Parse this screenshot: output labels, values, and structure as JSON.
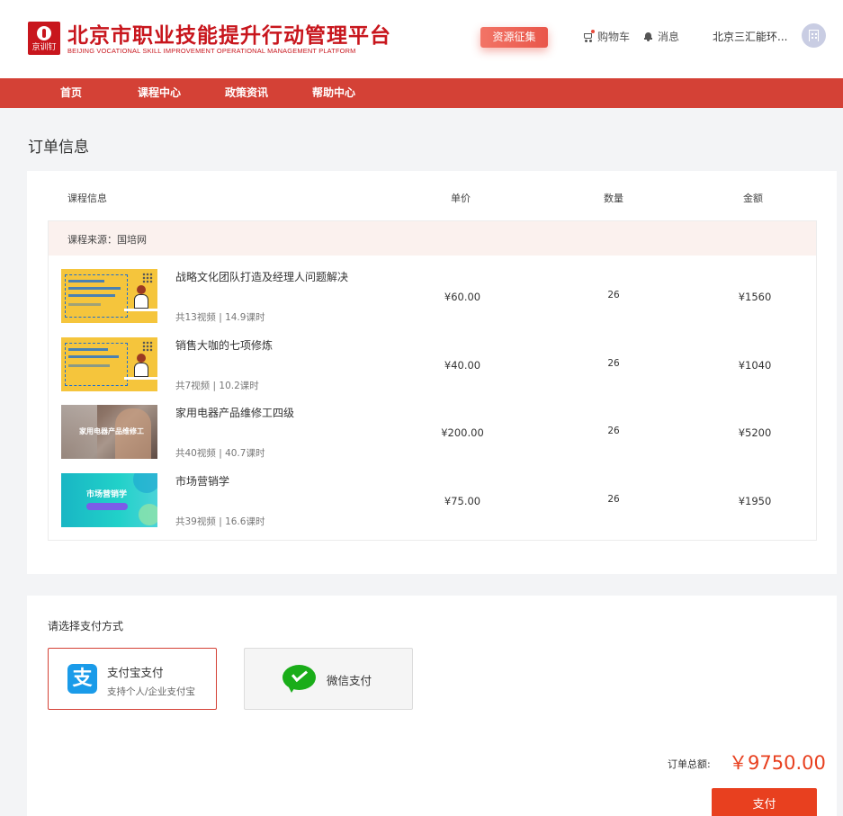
{
  "header": {
    "logo_mini_text": "京训钉",
    "brand_cn": "北京市职业技能提升行动管理平台",
    "brand_en": "BEIJING VOCATIONAL SKILL IMPROVEMENT OPERATIONAL MANAGEMENT PLATFORM",
    "resource_button": "资源征集",
    "cart_label": "购物车",
    "message_label": "消息",
    "user_name": "北京三汇能环..."
  },
  "nav": {
    "items": [
      "首页",
      "课程中心",
      "政策资讯",
      "帮助中心"
    ]
  },
  "page_title": "订单信息",
  "order_table": {
    "headers": {
      "course": "课程信息",
      "unit_price": "单价",
      "quantity": "数量",
      "amount": "金额"
    },
    "source": "课程来源：国培网",
    "rows": [
      {
        "name": "战略文化团队打造及经理人问题解决",
        "meta": "共13视频 | 14.9课时",
        "price": "¥60.00",
        "qty": "26",
        "amount": "¥1560",
        "thumb": "yellow-classroom"
      },
      {
        "name": "销售大咖的七项修炼",
        "meta": "共7视频 | 10.2课时",
        "price": "¥40.00",
        "qty": "26",
        "amount": "¥1040",
        "thumb": "yellow-classroom"
      },
      {
        "name": "家用电器产品维修工四级",
        "meta": "共40视频 | 40.7课时",
        "price": "¥200.00",
        "qty": "26",
        "amount": "¥5200",
        "thumb": "repair-photo",
        "thumb_caption": "家用电器产品维修工"
      },
      {
        "name": "市场营销学",
        "meta": "共39视频 | 16.6课时",
        "price": "¥75.00",
        "qty": "26",
        "amount": "¥1950",
        "thumb": "cyan-banner",
        "thumb_caption": "市场营销学"
      }
    ]
  },
  "payment": {
    "title": "请选择支付方式",
    "options": {
      "alipay_name": "支付宝支付",
      "alipay_desc": "支持个人/企业支付宝",
      "alipay_icon": "支",
      "wechat_name": "微信支付"
    },
    "selected": "alipay",
    "total_label": "订单总额:",
    "total_value": "￥9750.00",
    "pay_button": "支付"
  },
  "colors": {
    "brand_red": "#c8161d",
    "nav_red": "#d44136",
    "total_orange": "#e8401f",
    "alipay_blue": "#1a9be9",
    "wechat_green": "#1aad19"
  },
  "icons": [
    "cart-icon",
    "bell-icon",
    "avatar-building-icon",
    "alipay-icon",
    "wechat-pay-icon"
  ]
}
